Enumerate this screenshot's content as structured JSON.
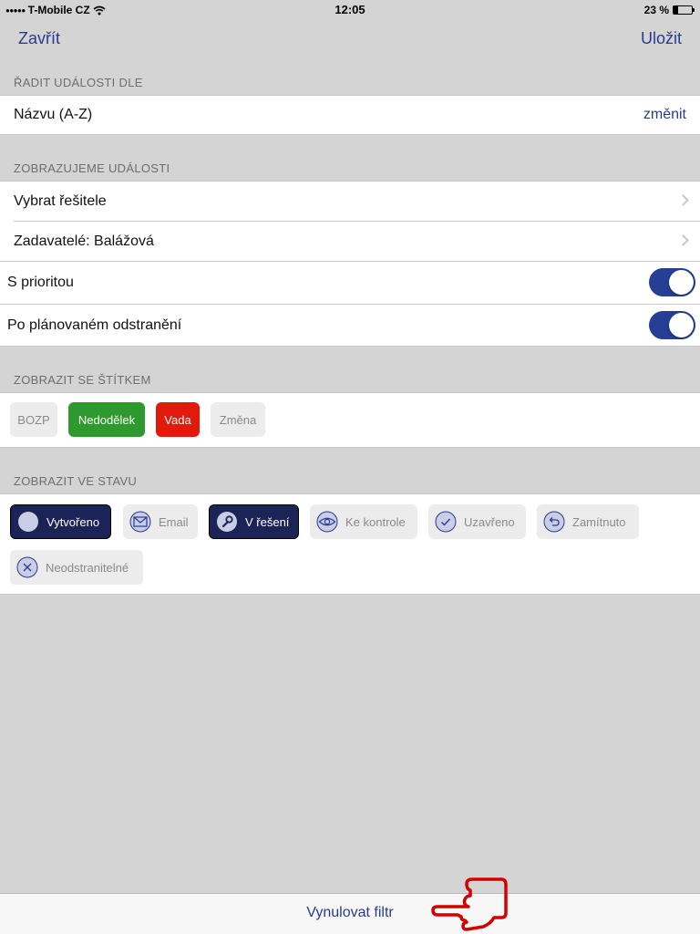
{
  "status_bar": {
    "carrier": "T-Mobile CZ",
    "signal_dots": "●●●●●",
    "time": "12:05",
    "battery": "23 %",
    "battery_level": 0.23
  },
  "nav": {
    "close_label": "Zavřít",
    "save_label": "Uložit"
  },
  "sort": {
    "header": "ŘADIT UDÁLOSTI DLE",
    "value": "Názvu (A-Z)",
    "change_label": "změnit"
  },
  "display": {
    "header": "ZOBRAZUJEME UDÁLOSTI",
    "solver_label": "Vybrat řešitele",
    "assigners_label": "Zadavatelé: Balážová",
    "priority_label": "S prioritou",
    "priority_on": true,
    "planned_label": "Po plánovaném odstranění",
    "planned_on": true
  },
  "tags": {
    "header": "ZOBRAZIT SE ŠTÍTKEM",
    "items": [
      "BOZP",
      "Nedodělek",
      "Vada",
      "Změna"
    ]
  },
  "states": {
    "header": "ZOBRAZIT VE STAVU",
    "items": [
      "Vytvořeno",
      "Email",
      "V řešení",
      "Ke kontrole",
      "Uzavřeno",
      "Zamítnuto",
      "Neodstranitelné"
    ]
  },
  "footer": {
    "reset_label": "Vynulovat filtr"
  },
  "colors": {
    "accent": "#2a3b8f",
    "toggle_on": "#243f94",
    "tag_green": "#2e9a2e",
    "tag_red": "#e21a0b",
    "state_active": "#1b2357",
    "pointer_annotation": "#d40000"
  }
}
